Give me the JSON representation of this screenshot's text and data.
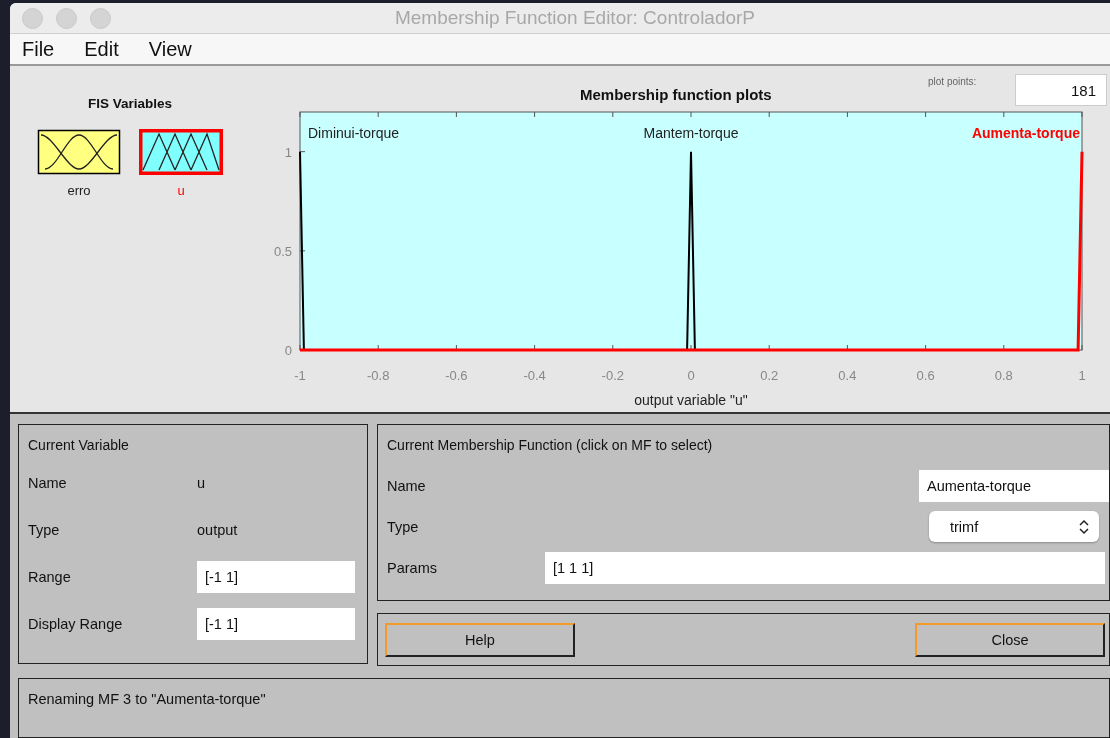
{
  "window": {
    "title": "Membership Function Editor: ControladorP"
  },
  "menu": [
    "File",
    "Edit",
    "View"
  ],
  "fis_variables": {
    "title": "FIS Variables",
    "items": [
      {
        "name": "erro",
        "kind": "input",
        "selected": false
      },
      {
        "name": "u",
        "kind": "output",
        "selected": true
      }
    ]
  },
  "plot": {
    "title": "Membership function plots",
    "points_label": "plot points:",
    "points": "181",
    "mf_selected": [
      false,
      false,
      true
    ],
    "chart_data": {
      "type": "line",
      "xlabel": "output variable \"u\"",
      "x": [
        -1,
        -0.99,
        -0.01,
        0,
        0.01,
        0.99,
        1
      ],
      "series": [
        {
          "name": "Diminui-torque",
          "color": "#000000",
          "values": [
            1,
            0,
            null,
            null,
            null,
            null,
            null
          ]
        },
        {
          "name": "Mantem-torque",
          "color": "#000000",
          "values": [
            null,
            null,
            0,
            1,
            0,
            null,
            null
          ]
        },
        {
          "name": "Aumenta-torque",
          "color": "#ff0000",
          "values": [
            0,
            0,
            0,
            0,
            0,
            0,
            1
          ]
        }
      ],
      "xlim": [
        -1,
        1
      ],
      "ylim": [
        0,
        1.2
      ],
      "xticks": [
        -1,
        -0.8,
        -0.6,
        -0.4,
        -0.2,
        0,
        0.2,
        0.4,
        0.6,
        0.8,
        1
      ],
      "yticks": [
        0,
        0.5,
        1
      ]
    }
  },
  "current_variable": {
    "title": "Current Variable",
    "name_label": "Name",
    "name": "u",
    "type_label": "Type",
    "type": "output",
    "range_label": "Range",
    "range": "[-1 1]",
    "display_range_label": "Display Range",
    "display_range": "[-1 1]"
  },
  "current_mf": {
    "title": "Current Membership Function (click on MF to select)",
    "name_label": "Name",
    "name": "Aumenta-torque",
    "type_label": "Type",
    "type": "trimf",
    "params_label": "Params",
    "params": "[1 1 1]"
  },
  "buttons": [
    "Help",
    "Close"
  ],
  "status": "Renaming MF 3 to \"Aumenta-torque\""
}
